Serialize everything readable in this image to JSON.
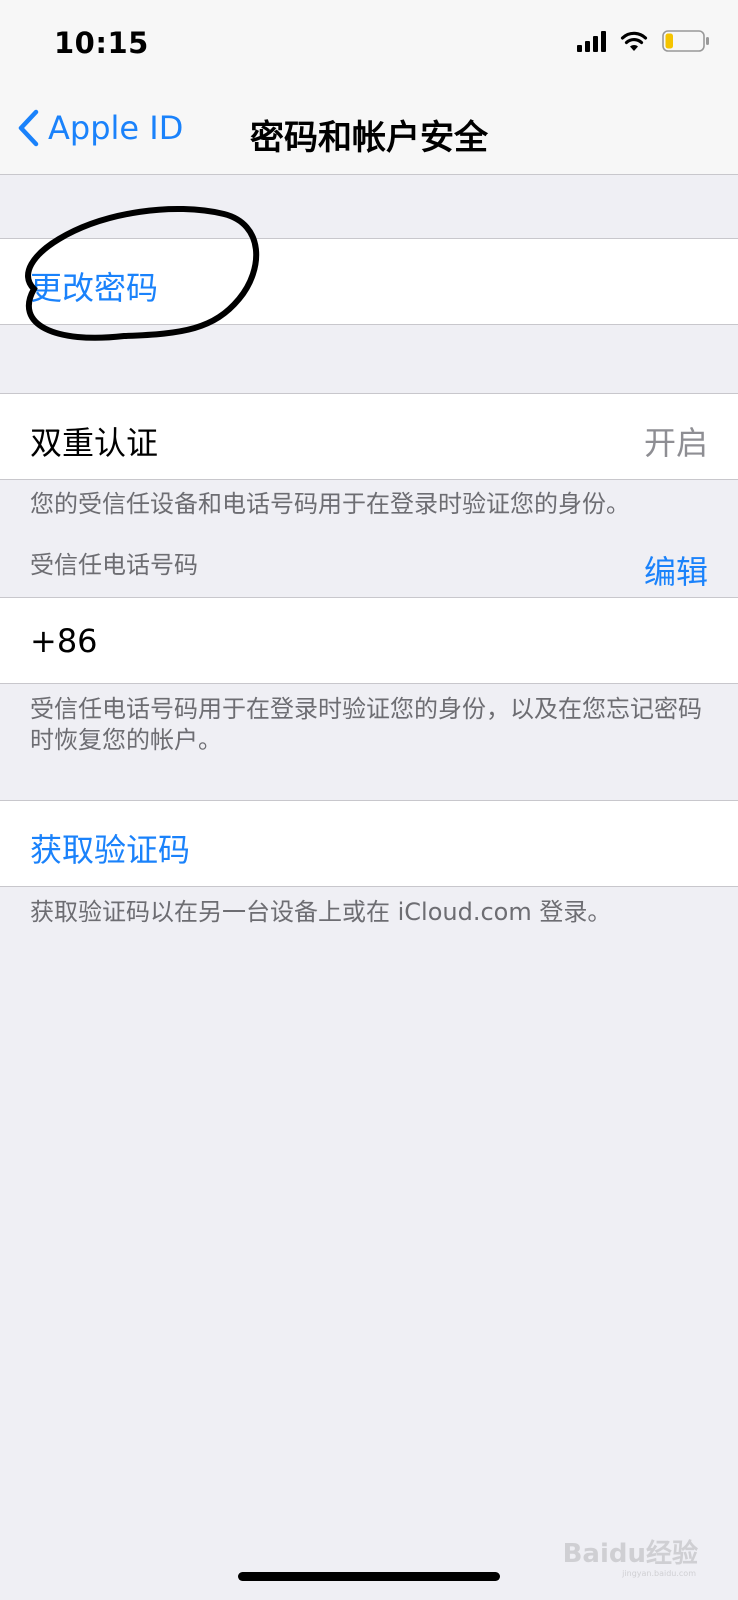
{
  "status_bar": {
    "time": "10:15"
  },
  "nav": {
    "back_label": "Apple ID",
    "title": "密码和帐户安全"
  },
  "change_password": {
    "label": "更改密码"
  },
  "two_factor": {
    "label": "双重认证",
    "value": "开启",
    "footnote": "您的受信任设备和电话号码用于在登录时验证您的身份。"
  },
  "trusted_phone": {
    "header": "受信任电话号码",
    "edit_label": "编辑",
    "number": "+86 1",
    "footnote": "受信任电话号码用于在登录时验证您的身份，以及在您忘记密码时恢复您的帐户。"
  },
  "get_code": {
    "label": "获取验证码",
    "footnote": "获取验证码以在另一台设备上或在 iCloud.com 登录。"
  },
  "watermark": {
    "brand": "Baidu经验",
    "url": "jingyan.baidu.com"
  },
  "colors": {
    "accent": "#1a82fb",
    "background": "#efeff4",
    "battery_level": "#f5c400"
  },
  "battery_level_fraction": 0.2
}
